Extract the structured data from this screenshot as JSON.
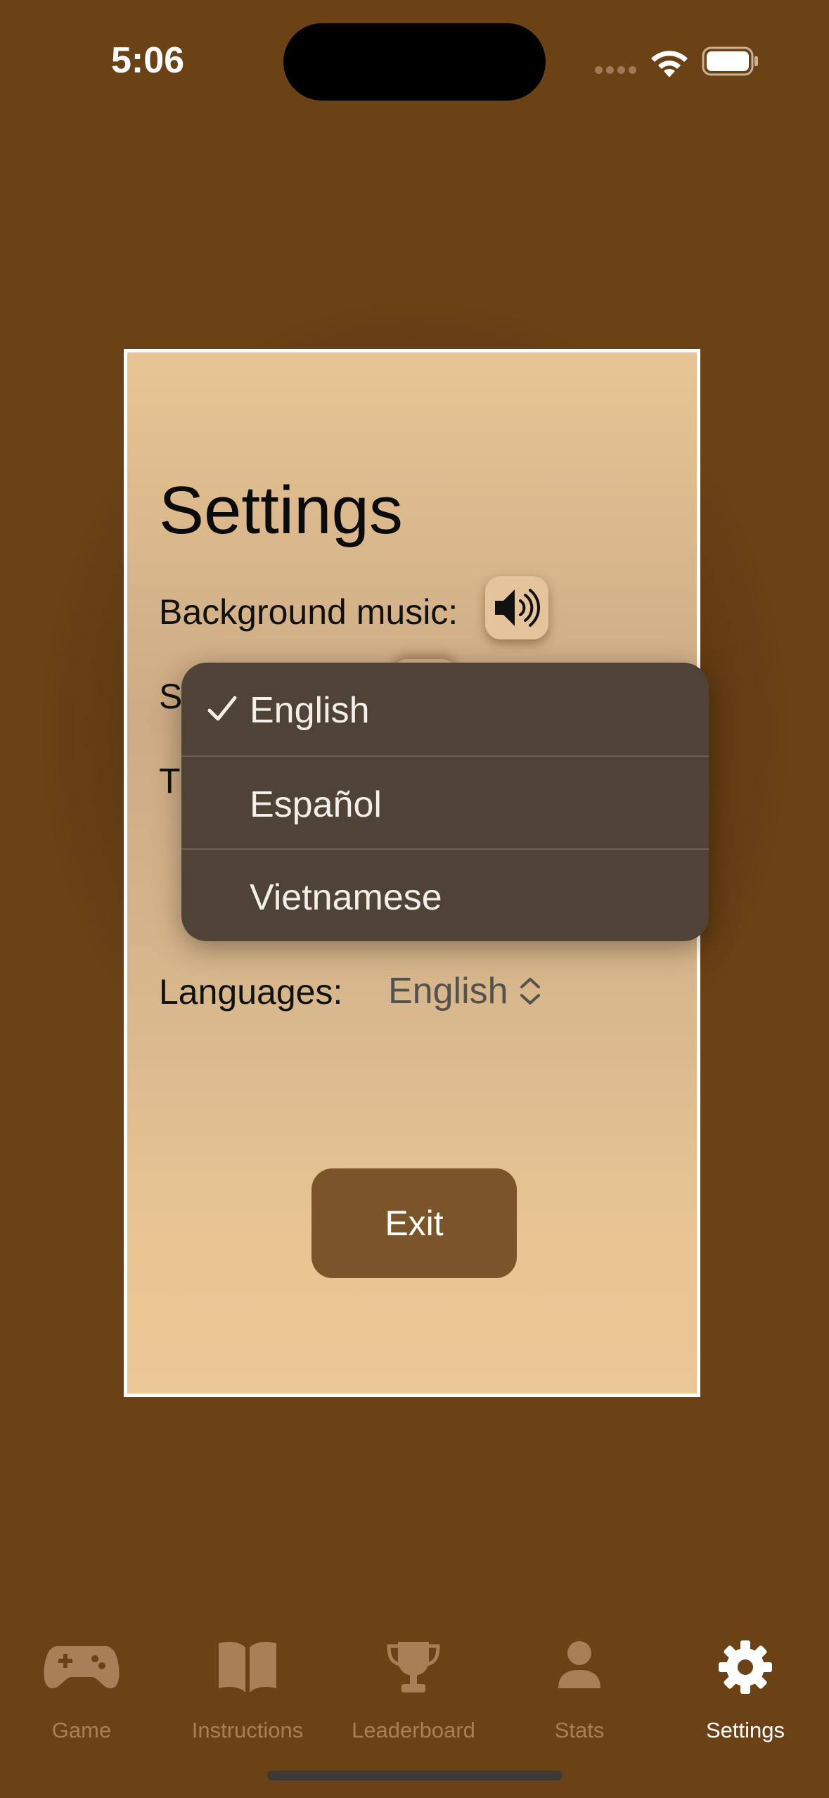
{
  "status_bar": {
    "time": "5:06"
  },
  "settings": {
    "title": "Settings",
    "background_music_label": "Background music:",
    "sound_effects_label_partial": "S",
    "theme_label_partial": "T",
    "languages_label": "Languages:",
    "selected_language": "English",
    "exit_label": "Exit"
  },
  "language_menu": {
    "items": [
      {
        "label": "English",
        "checked": true
      },
      {
        "label": "Español",
        "checked": false
      },
      {
        "label": "Vietnamese",
        "checked": false
      }
    ]
  },
  "tabbar": {
    "items": [
      {
        "label": "Game",
        "icon": "gamepad-icon",
        "active": false
      },
      {
        "label": "Instructions",
        "icon": "book-icon",
        "active": false
      },
      {
        "label": "Leaderboard",
        "icon": "trophy-icon",
        "active": false
      },
      {
        "label": "Stats",
        "icon": "person-icon",
        "active": false
      },
      {
        "label": "Settings",
        "icon": "gear-icon",
        "active": true
      }
    ]
  },
  "colors": {
    "background": "#6b4116",
    "card_top": "#e8c594",
    "menu_bg": "#4f4338",
    "exit_button": "#7a5529",
    "tab_inactive": "#a88058",
    "tab_active": "#ffffff"
  }
}
